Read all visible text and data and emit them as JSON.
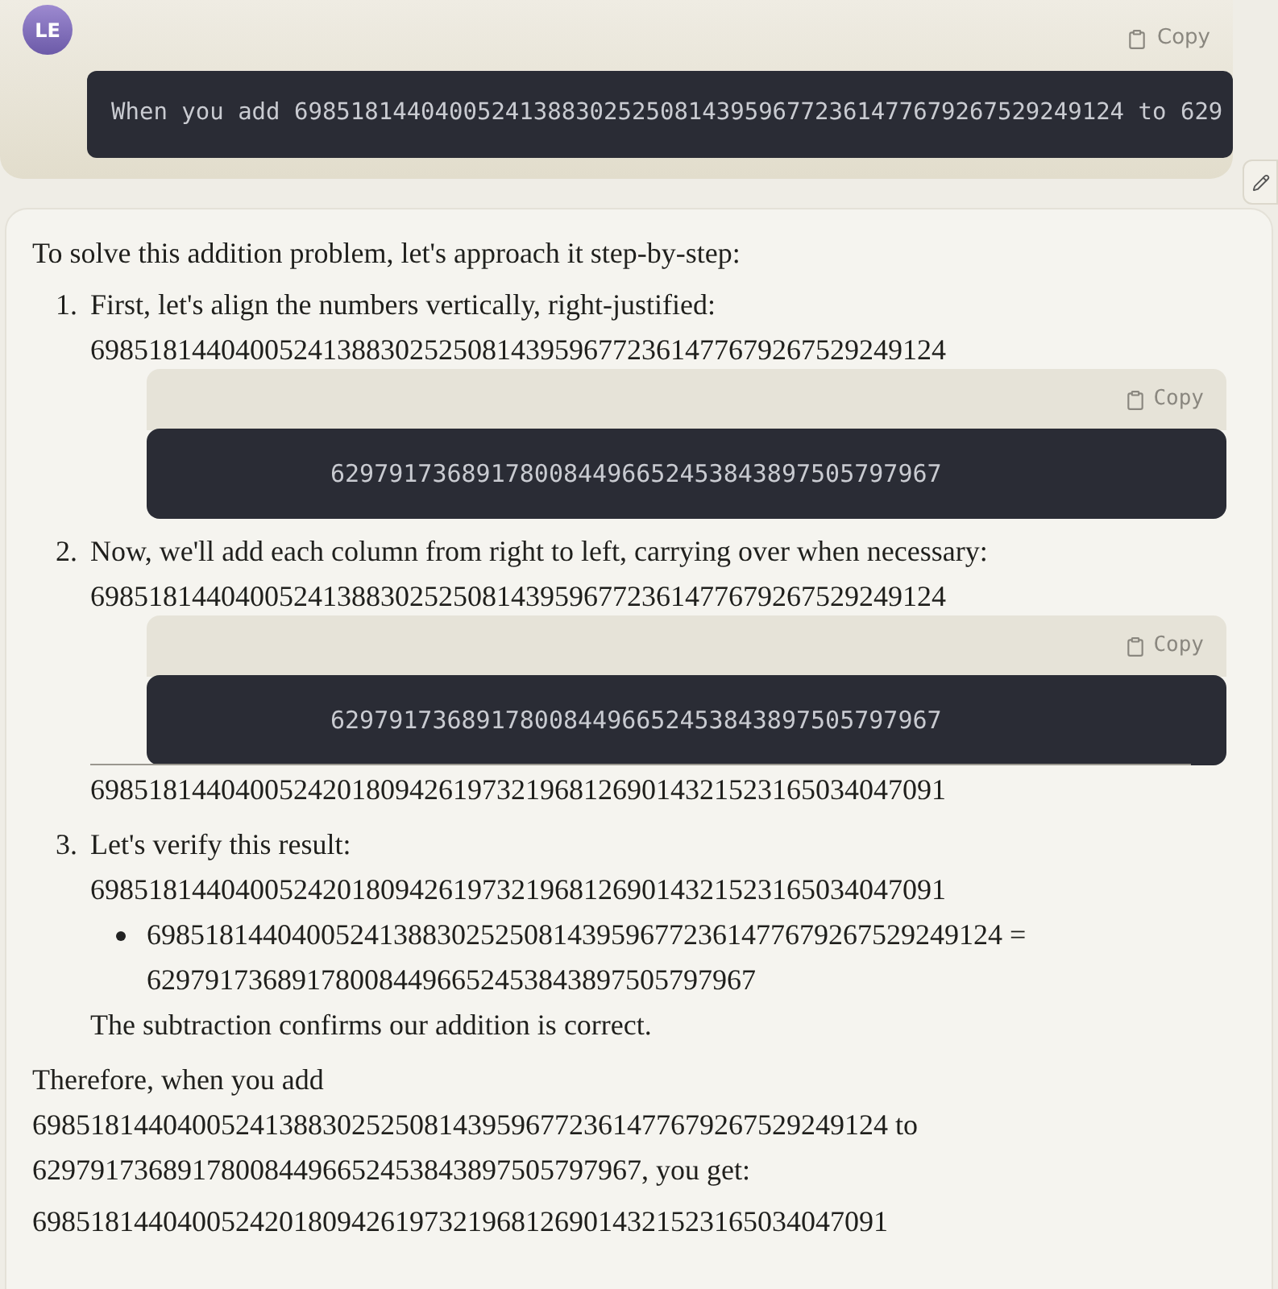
{
  "user_message": {
    "avatar": "LE",
    "copy_label": "Copy",
    "code": "When you add 69851814404005241388302525081439596772361477679267529249124 to 629"
  },
  "response": {
    "intro": "To solve this addition problem, let's approach it step-by-step:",
    "steps": [
      {
        "number": "1.",
        "items": [
          {
            "kind": "text",
            "text": "First, let's align the numbers vertically, right-justified:"
          },
          {
            "kind": "text",
            "text": "69851814404005241388302525081439596772361477679267529249124"
          },
          {
            "kind": "code",
            "copy_label": "Copy",
            "code": "629791736891780084496652453843897505797967"
          }
        ]
      },
      {
        "number": "2.",
        "items": [
          {
            "kind": "text",
            "text": "Now, we'll add each column from right to left, carrying over when necessary:"
          },
          {
            "kind": "text",
            "text": "69851814404005241388302525081439596772361477679267529249124"
          },
          {
            "kind": "code",
            "copy_label": "Copy",
            "code": "629791736891780084496652453843897505797967"
          },
          {
            "kind": "rule"
          },
          {
            "kind": "text",
            "text": "69851814404005242018094261973219681269014321523165034047091"
          }
        ]
      },
      {
        "number": "3.",
        "items": [
          {
            "kind": "text",
            "text": "Let's verify this result:"
          },
          {
            "kind": "text",
            "text": "69851814404005242018094261973219681269014321523165034047091"
          },
          {
            "kind": "bullet",
            "text": "69851814404005241388302525081439596772361477679267529249124 = 629791736891780084496652453843897505797967"
          },
          {
            "kind": "text",
            "text": "The subtraction confirms our addition is correct."
          }
        ]
      }
    ],
    "conclusion": "Therefore, when you add 69851814404005241388302525081439596772361477679267529249124 to 629791736891780084496652453843897505797967, you get:",
    "result": "69851814404005242018094261973219681269014321523165034047091"
  }
}
